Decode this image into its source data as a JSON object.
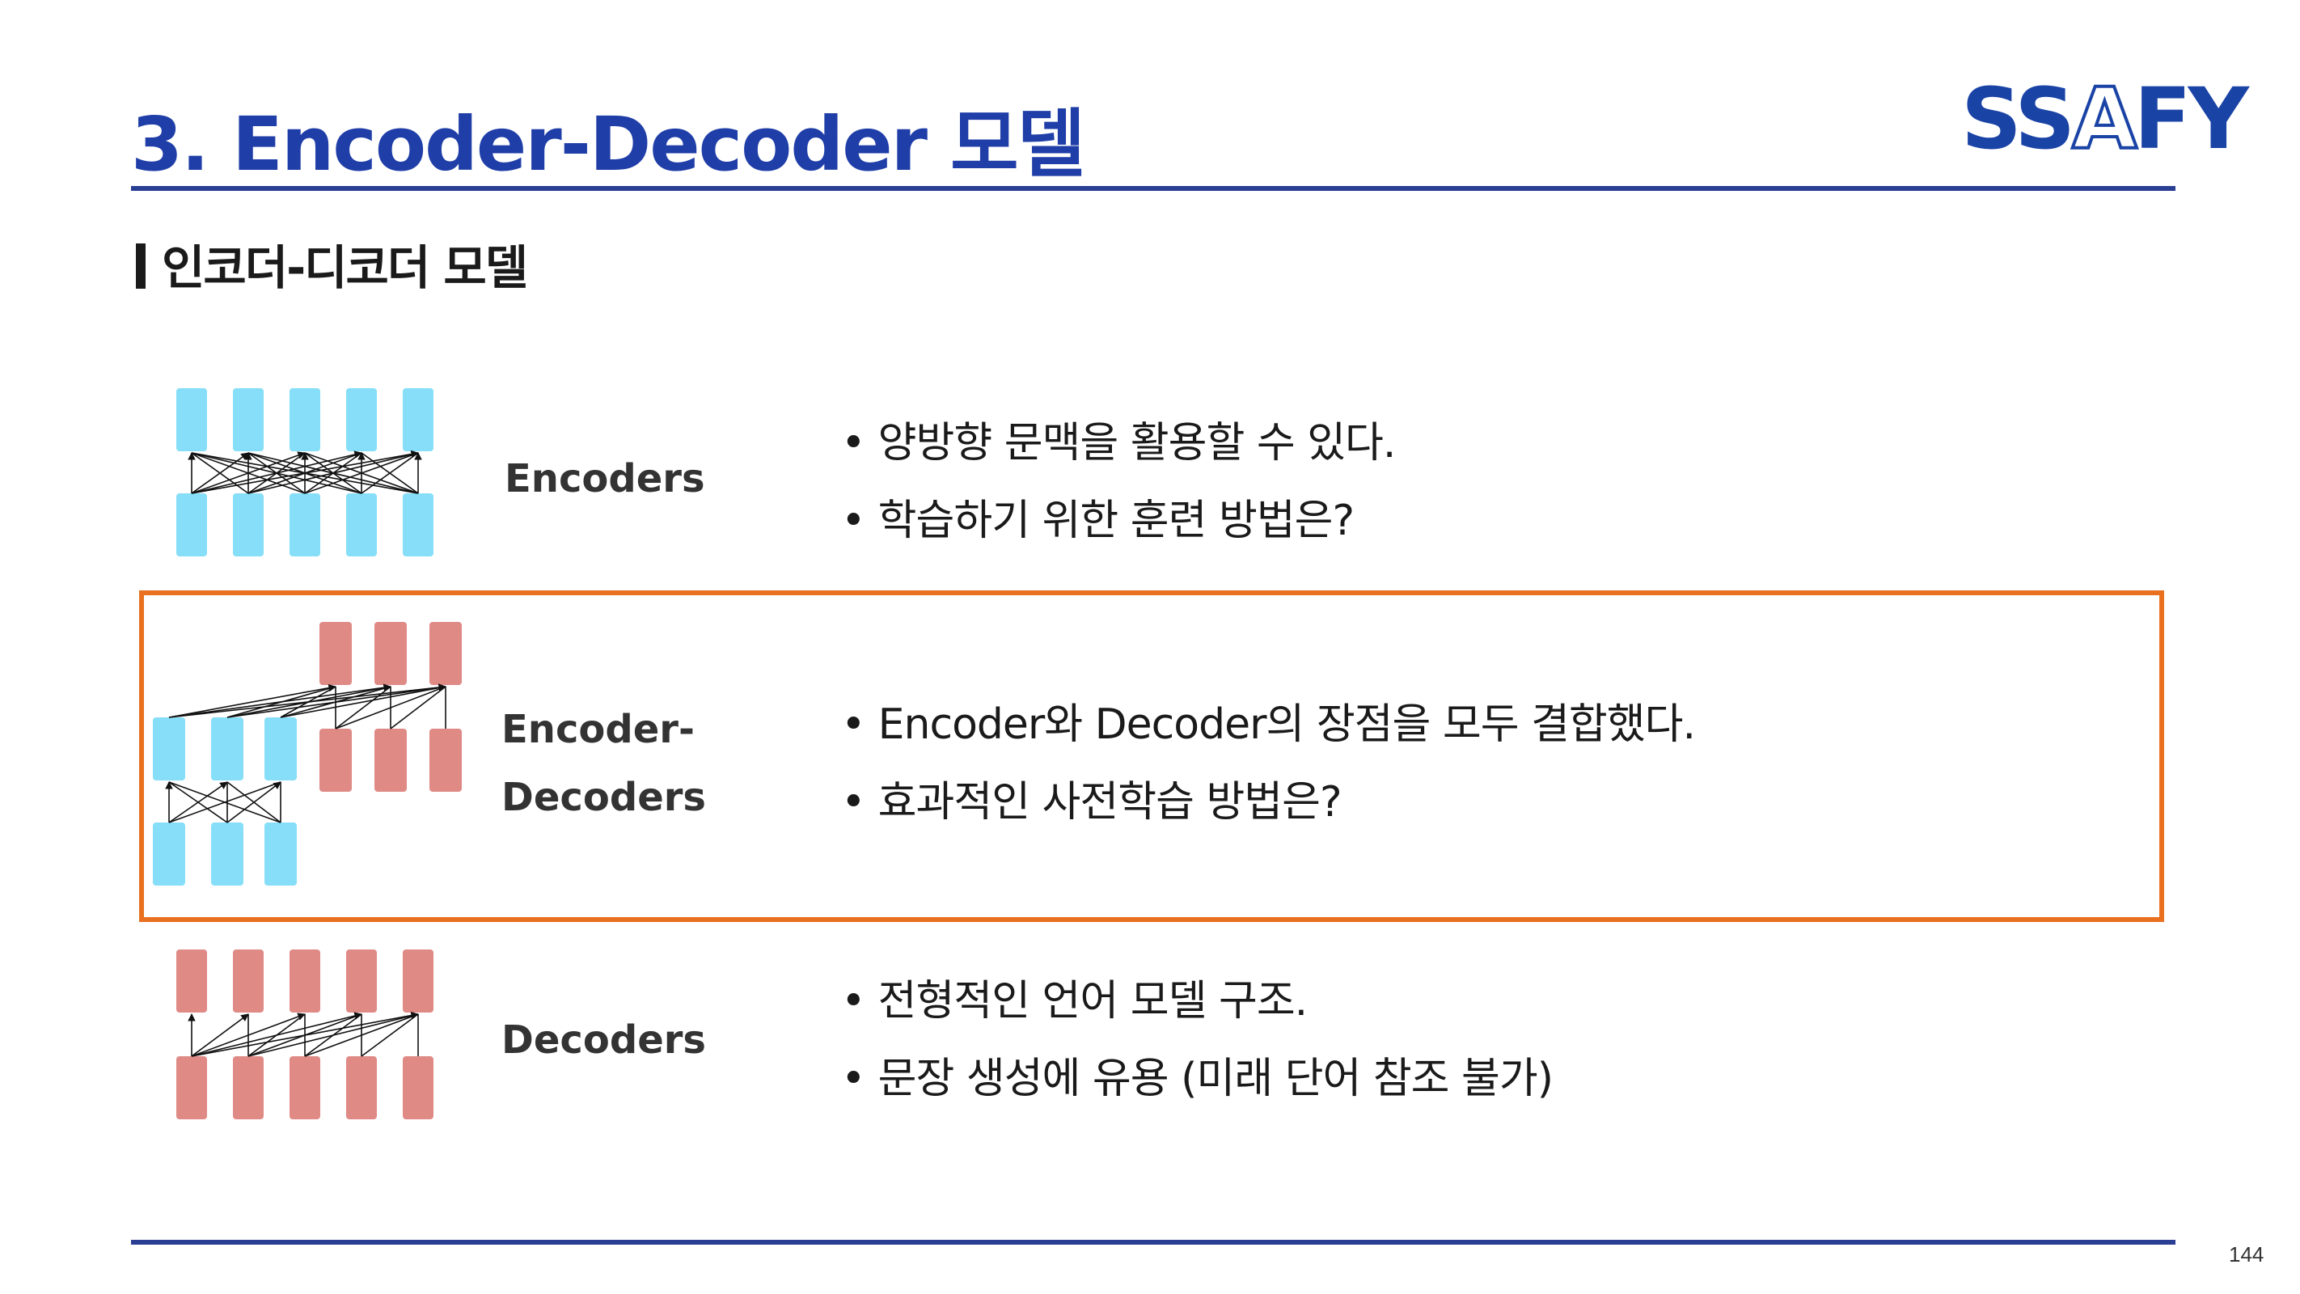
{
  "header": {
    "title": "3. Encoder-Decoder 모델",
    "logo_text": [
      "SS",
      "A",
      "FY"
    ]
  },
  "section": {
    "heading": "인코더-디코더 모델"
  },
  "rows": [
    {
      "label_lines": [
        "Encoders"
      ],
      "bullets": [
        "양방향 문맥을 활용할 수 있다.",
        "학습하기 위한 훈련 방법은?"
      ]
    },
    {
      "label_lines": [
        "Encoder-",
        "Decoders"
      ],
      "bullets": [
        "Encoder와 Decoder의 장점을 모두 결합했다.",
        "효과적인 사전학습 방법은?"
      ]
    },
    {
      "label_lines": [
        "Decoders"
      ],
      "bullets": [
        "전형적인 언어 모델 구조.",
        "문장 생성에 유용 (미래 단어 참조 불가)"
      ]
    }
  ],
  "bullet_symbol": "•",
  "page_number": "144",
  "colors": {
    "title_blue": "#1f3ea8",
    "rule_navy": "#2a3f93",
    "encoder_block": "#86def8",
    "decoder_block": "#e08a86",
    "highlight_orange": "#e8701e"
  }
}
